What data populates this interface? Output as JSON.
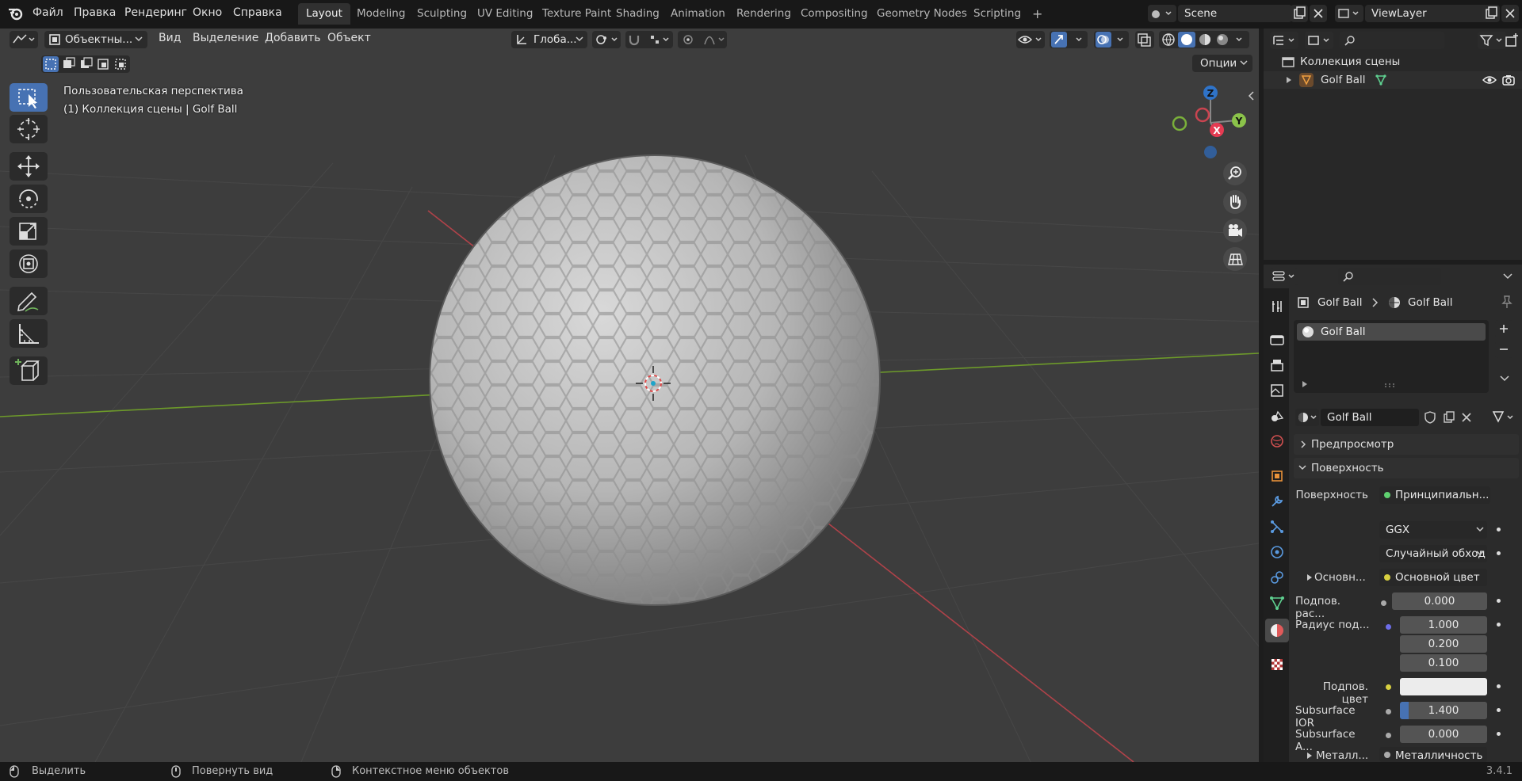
{
  "topbar": {
    "menus": [
      "Файл",
      "Правка",
      "Рендеринг",
      "Окно",
      "Справка"
    ],
    "workspaces": [
      "Layout",
      "Modeling",
      "Sculpting",
      "UV Editing",
      "Texture Paint",
      "Shading",
      "Animation",
      "Rendering",
      "Compositing",
      "Geometry Nodes",
      "Scripting"
    ],
    "active_workspace": "Layout",
    "add_tab": "+",
    "scene": "Scene",
    "view_layer": "ViewLayer"
  },
  "viewport": {
    "mode": "Объектны...",
    "menus": [
      "Вид",
      "Выделение",
      "Добавить",
      "Объект"
    ],
    "orientation": "Глоба...",
    "options": "Опции",
    "overlay_line1": "Пользовательская перспектива",
    "overlay_line2": "(1) Коллекция сцены | Golf Ball",
    "gizmo": {
      "z": "Z",
      "y": "Y",
      "x": "X"
    }
  },
  "outliner": {
    "scene_collection": "Коллекция сцены",
    "object": "Golf Ball"
  },
  "properties": {
    "breadcrumb_object": "Golf Ball",
    "breadcrumb_material": "Golf Ball",
    "slot_name": "Golf Ball",
    "material_name": "Golf Ball",
    "sections": {
      "preview": "Предпросмотр",
      "surface": "Поверхность"
    },
    "rows": {
      "surface_label": "Поверхность",
      "surface_value": "Принципиальн...",
      "distribution": "GGX",
      "subsurface_method": "Случайный обход",
      "base_label": "Основн...",
      "base_value": "Основной цвет",
      "subsurface_label": "Подпов. рас...",
      "subsurface_value": "0.000",
      "radius_label": "Радиус под...",
      "radius_values": [
        "1.000",
        "0.200",
        "0.100"
      ],
      "subsurface_color_label": "Подпов. цвет",
      "ior_label": "Subsurface IOR",
      "ior_value": "1.400",
      "aniso_label": "Subsurface A...",
      "aniso_value": "0.000",
      "metal_label": "Металл...",
      "metal_value": "Металличность"
    }
  },
  "status": {
    "select": "Выделить",
    "rotate": "Повернуть вид",
    "context": "Контекстное меню объектов",
    "version": "3.4.1"
  },
  "colors": {
    "accent": "#4772b3",
    "viewport_bg": "#3d3d3d",
    "x_axis": "#d8434e",
    "y_axis": "#7fae2e"
  }
}
